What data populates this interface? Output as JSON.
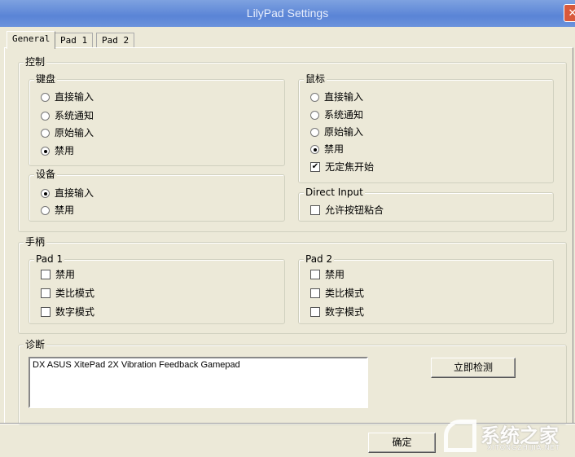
{
  "window": {
    "title": "LilyPad Settings",
    "close": "✕"
  },
  "tabs": [
    "General",
    "Pad 1",
    "Pad 2"
  ],
  "control": {
    "label": "控制",
    "keyboard": {
      "label": "键盘",
      "options": [
        "直接输入",
        "系统通知",
        "原始输入",
        "禁用"
      ],
      "selected": 3
    },
    "device": {
      "label": "设备",
      "options": [
        "直接输入",
        "禁用"
      ],
      "selected": 0
    },
    "mouse": {
      "label": "鼠标",
      "options": [
        "直接输入",
        "系统通知",
        "原始输入",
        "禁用"
      ],
      "selected": 3,
      "checkbox": "无定焦开始",
      "checkbox_checked": true
    },
    "direct_input": {
      "label": "Direct Input",
      "checkbox": "允许按钮粘合",
      "checked": false
    }
  },
  "gamepad": {
    "label": "手柄",
    "pad1": {
      "label": "Pad 1",
      "options": [
        "禁用",
        "类比模式",
        "数字模式"
      ]
    },
    "pad2": {
      "label": "Pad 2",
      "options": [
        "禁用",
        "类比模式",
        "数字模式"
      ]
    }
  },
  "diagnostics": {
    "label": "诊断",
    "devices": "DX ASUS XitePad 2X Vibration Feedback Gamepad",
    "detect_button": "立即检测"
  },
  "ok_button": "确定",
  "watermark": {
    "text": "系统之家",
    "url": "XITONGZHIJIA.NET"
  }
}
